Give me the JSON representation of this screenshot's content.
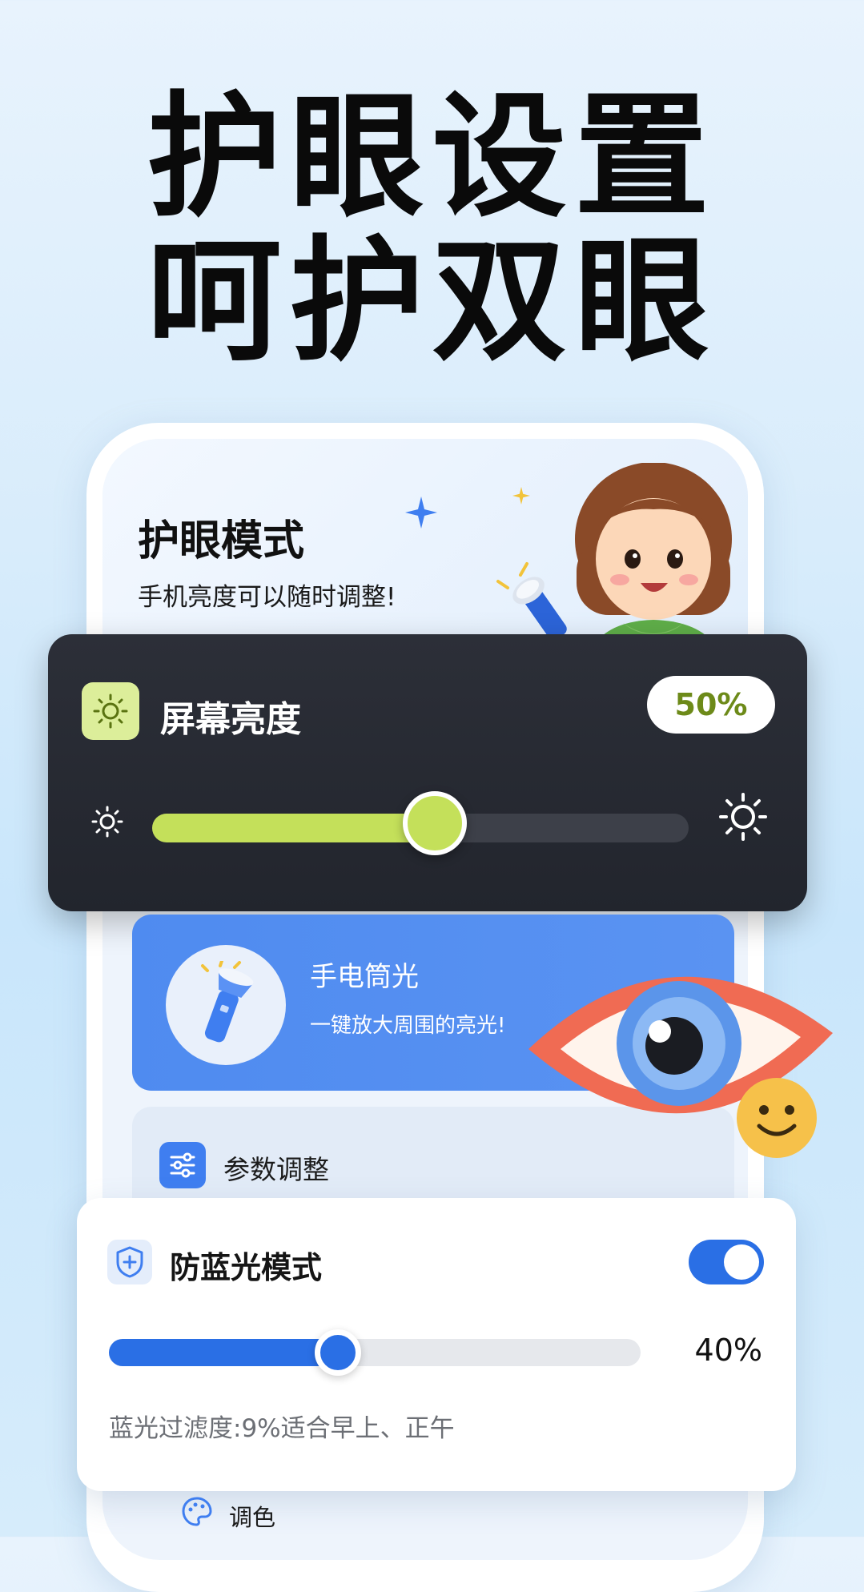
{
  "headline": {
    "line1": "护眼设置",
    "line2": "呵护双眼"
  },
  "eye_mode": {
    "title": "护眼模式",
    "subtitle": "手机亮度可以随时调整!"
  },
  "brightness": {
    "title": "屏幕亮度",
    "value_label": "50%",
    "level": 0.5
  },
  "flashlight": {
    "title": "手电筒光",
    "subtitle": "一键放大周围的亮光!"
  },
  "params": {
    "label": "参数调整"
  },
  "blue_light": {
    "title": "防蓝光模式",
    "enabled": true,
    "level": 0.4,
    "value_label": "40%",
    "note": "蓝光过滤度:9%适合早上、正午"
  },
  "palette": {
    "label": "调色"
  },
  "colors": {
    "brightness_accent": "#c4e05a",
    "blue_accent": "#2a6fe5",
    "flash_card": "#4f8bf0",
    "dark_card": "#262932"
  },
  "icons": [
    "sun-icon",
    "sun-small-icon",
    "sun-large-icon",
    "flashlight-icon",
    "sliders-icon",
    "shield-icon",
    "palette-icon",
    "eye-illustration",
    "girl-illustration",
    "sparkle-icon",
    "smiley-icon"
  ]
}
